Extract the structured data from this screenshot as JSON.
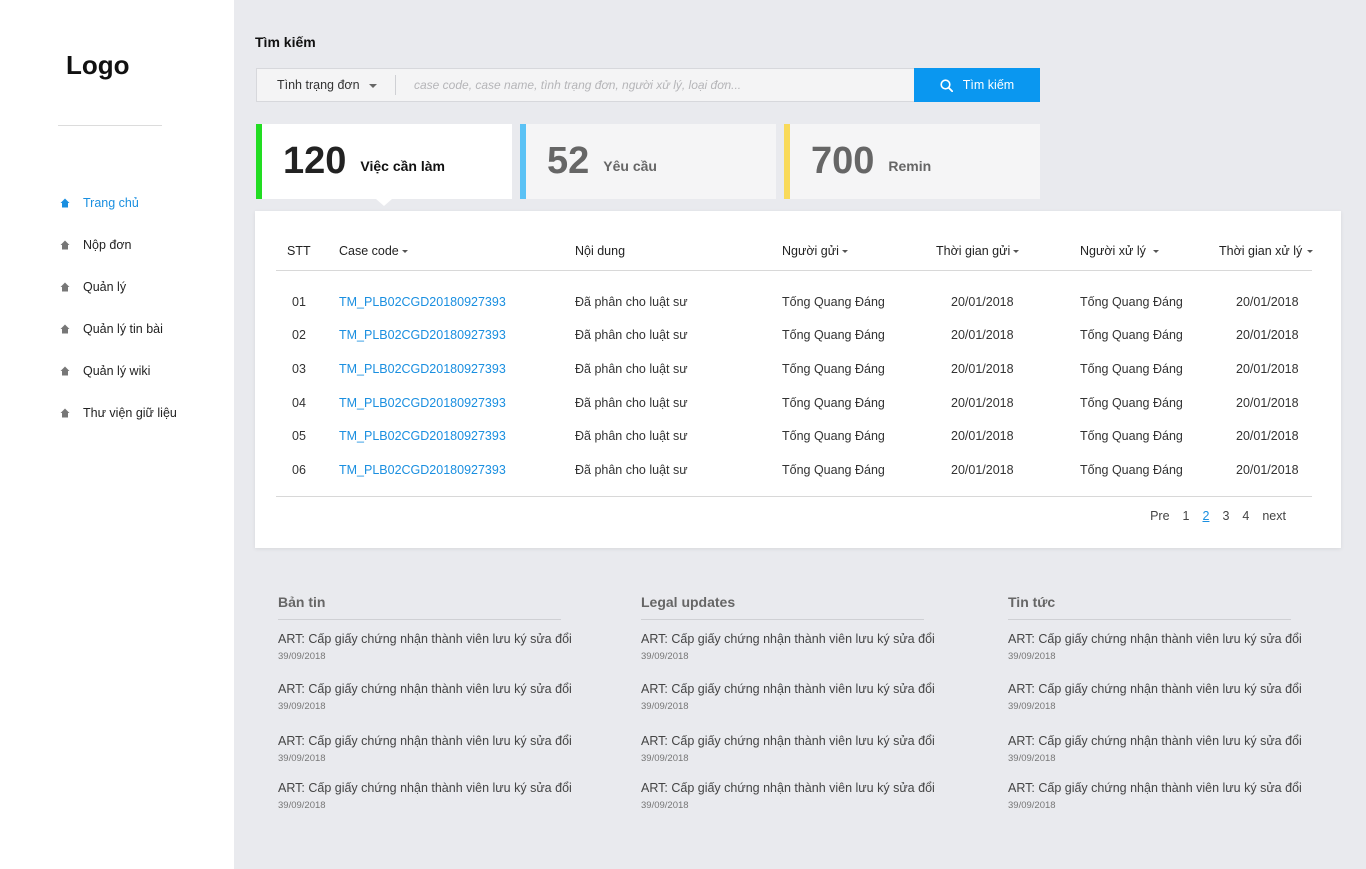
{
  "sidebar": {
    "logo": "Logo",
    "items": [
      {
        "label": "Trang chủ",
        "active": true
      },
      {
        "label": "Nộp đơn",
        "active": false
      },
      {
        "label": "Quản lý",
        "active": false
      },
      {
        "label": "Quản lý tin bài",
        "active": false
      },
      {
        "label": "Quản lý wiki",
        "active": false
      },
      {
        "label": "Thư viện giữ liệu",
        "active": false
      }
    ]
  },
  "search": {
    "title": "Tìm kiếm",
    "status_select": "Tình trạng đơn",
    "placeholder": "case code, case name, tình trạng đơn, người xử lý, loại đơn...",
    "button_label": "Tìm kiếm"
  },
  "cards": [
    {
      "number": "120",
      "label": "Việc cần làm",
      "color": "#22dd22",
      "active": true
    },
    {
      "number": "52",
      "label": "Yêu cầu",
      "color": "#5bc2f5",
      "active": false
    },
    {
      "number": "700",
      "label": "Remin",
      "color": "#f9da5a",
      "active": false
    }
  ],
  "table": {
    "headers": [
      "STT",
      "Case code",
      "Nội dung",
      "Người gửi",
      "Thời gian gửi",
      "Người xử lý",
      "Thời gian xử lý"
    ],
    "rows": [
      [
        "01",
        "TM_PLB02CGD20180927393",
        "Đã phân cho luật sư",
        "Tống Quang Đáng",
        "20/01/2018",
        "Tống Quang Đáng",
        "20/01/2018"
      ],
      [
        "02",
        "TM_PLB02CGD20180927393",
        "Đã phân cho luật sư",
        "Tống Quang Đáng",
        "20/01/2018",
        "Tống Quang Đáng",
        "20/01/2018"
      ],
      [
        "03",
        "TM_PLB02CGD20180927393",
        "Đã phân cho luật sư",
        "Tống Quang Đáng",
        "20/01/2018",
        "Tống Quang Đáng",
        "20/01/2018"
      ],
      [
        "04",
        "TM_PLB02CGD20180927393",
        "Đã phân cho luật sư",
        "Tống Quang Đáng",
        "20/01/2018",
        "Tống Quang Đáng",
        "20/01/2018"
      ],
      [
        "05",
        "TM_PLB02CGD20180927393",
        "Đã phân cho luật sư",
        "Tống Quang Đáng",
        "20/01/2018",
        "Tống Quang Đáng",
        "20/01/2018"
      ],
      [
        "06",
        "TM_PLB02CGD20180927393",
        "Đã phân cho luật sư",
        "Tống Quang Đáng",
        "20/01/2018",
        "Tống Quang Đáng",
        "20/01/2018"
      ]
    ]
  },
  "pagination": {
    "prev": "Pre",
    "pages": [
      "1",
      "2",
      "3",
      "4"
    ],
    "current": "2",
    "next": "next"
  },
  "news": [
    {
      "title": "Bản tin",
      "items": [
        {
          "headline": "ART: Cấp giấy chứng nhận thành viên lưu ký sửa đổi",
          "date": "39/09/2018"
        },
        {
          "headline": "ART: Cấp giấy chứng nhận thành viên lưu ký sửa đổi",
          "date": "39/09/2018"
        },
        {
          "headline": "ART: Cấp giấy chứng nhận thành viên lưu ký sửa đổi",
          "date": "39/09/2018"
        },
        {
          "headline": "ART: Cấp giấy chứng nhận thành viên lưu ký sửa đổi",
          "date": "39/09/2018"
        }
      ]
    },
    {
      "title": "Legal updates",
      "items": [
        {
          "headline": "ART: Cấp giấy chứng nhận thành viên lưu ký sửa đổi",
          "date": "39/09/2018"
        },
        {
          "headline": "ART: Cấp giấy chứng nhận thành viên lưu ký sửa đổi",
          "date": "39/09/2018"
        },
        {
          "headline": "ART: Cấp giấy chứng nhận thành viên lưu ký sửa đổi",
          "date": "39/09/2018"
        },
        {
          "headline": "ART: Cấp giấy chứng nhận thành viên lưu ký sửa đổi",
          "date": "39/09/2018"
        }
      ]
    },
    {
      "title": "Tin tức",
      "items": [
        {
          "headline": "ART: Cấp giấy chứng nhận thành viên lưu ký sửa đổi",
          "date": "39/09/2018"
        },
        {
          "headline": "ART: Cấp giấy chứng nhận thành viên lưu ký sửa đổi",
          "date": "39/09/2018"
        },
        {
          "headline": "ART: Cấp giấy chứng nhận thành viên lưu ký sửa đổi",
          "date": "39/09/2018"
        },
        {
          "headline": "ART: Cấp giấy chứng nhận thành viên lưu ký sửa đổi",
          "date": "39/09/2018"
        }
      ]
    }
  ],
  "colors": {
    "accent": "#0a97f0",
    "link": "#1a8fe0",
    "background": "#e9eaee"
  },
  "icons": {
    "nav": "home-icon",
    "search": "search-icon",
    "dropdown": "chevron-down-icon"
  }
}
